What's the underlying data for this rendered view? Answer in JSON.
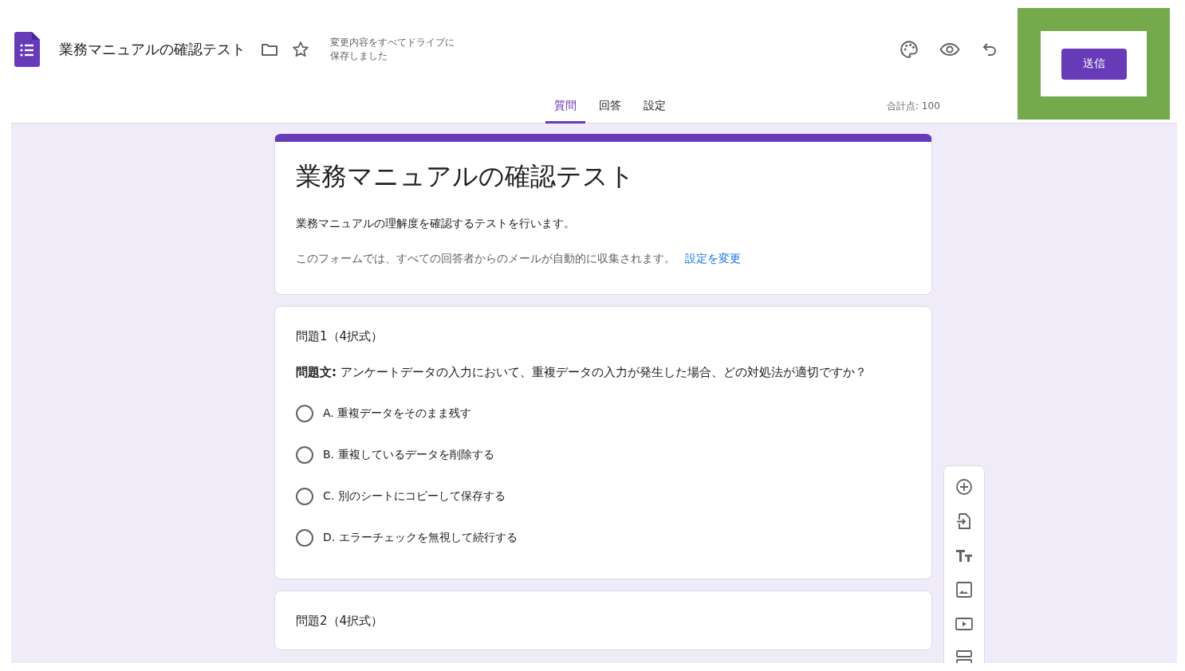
{
  "header": {
    "title": "業務マニュアルの確認テスト",
    "save_status": [
      "変更内容をすべてドライブに",
      "保存しました"
    ],
    "send_button": "送信",
    "total_points": "合計点: 100"
  },
  "tabs": [
    {
      "label": "質問",
      "selected": true
    },
    {
      "label": "回答",
      "selected": false
    },
    {
      "label": "設定",
      "selected": false
    }
  ],
  "form": {
    "title": "業務マニュアルの確認テスト",
    "description": "業務マニュアルの理解度を確認するテストを行います。",
    "email_notice": "このフォームでは、すべての回答者からのメールが自動的に収集されます。",
    "email_link": "設定を変更"
  },
  "questions": [
    {
      "title": "問題1（4択式）",
      "prompt": "**問題文:** アンケートデータの入力において、重複データの入力が発生した場合、どの対処法が適切ですか？",
      "options": [
        {
          "label": "A. 重複データをそのまま残す",
          "selected": false
        },
        {
          "label": "B. 重複しているデータを削除する",
          "selected": false
        },
        {
          "label": "C. 別のシートにコピーして保存する",
          "selected": false
        },
        {
          "label": "D. エラーチェックを無視して続行する",
          "selected": false
        }
      ]
    },
    {
      "title": "問題2（4択式）"
    }
  ]
}
